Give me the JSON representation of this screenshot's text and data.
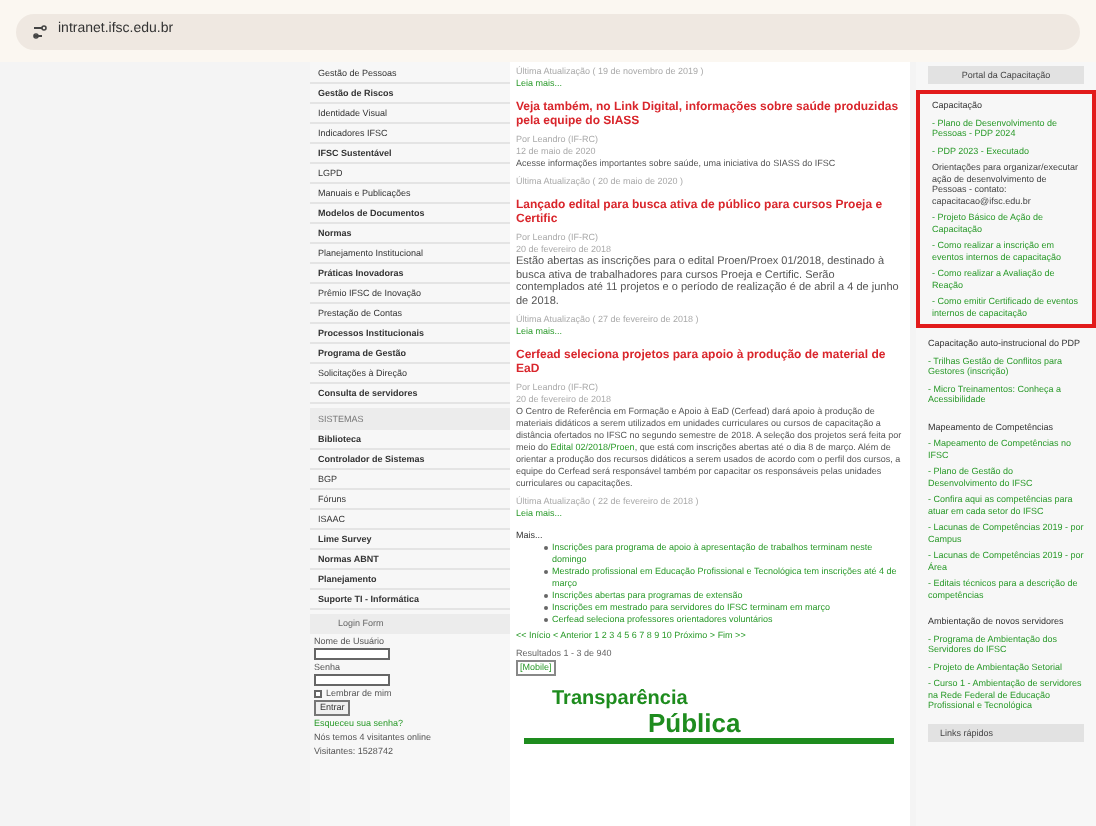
{
  "address_bar": {
    "url": "intranet.ifsc.edu.br"
  },
  "sidebar": {
    "menu": [
      {
        "label": "Gestão de Pessoas",
        "bold": false
      },
      {
        "label": "Gestão de Riscos",
        "bold": true
      },
      {
        "label": "Identidade Visual",
        "bold": false
      },
      {
        "label": "Indicadores IFSC",
        "bold": false
      },
      {
        "label": "IFSC Sustentável",
        "bold": true
      },
      {
        "label": "LGPD",
        "bold": false
      },
      {
        "label": "Manuais e Publicações",
        "bold": false
      },
      {
        "label": "Modelos de Documentos",
        "bold": true
      },
      {
        "label": "Normas",
        "bold": true
      },
      {
        "label": "Planejamento Institucional",
        "bold": false
      },
      {
        "label": "Práticas Inovadoras",
        "bold": true
      },
      {
        "label": "Prêmio IFSC de Inovação",
        "bold": false
      },
      {
        "label": "Prestação de Contas",
        "bold": false
      },
      {
        "label": "Processos Institucionais",
        "bold": true
      },
      {
        "label": "Programa de Gestão",
        "bold": true
      },
      {
        "label": "Solicitações à Direção",
        "bold": false
      },
      {
        "label": "Consulta de servidores",
        "bold": true
      }
    ],
    "systems_heading": "SISTEMAS",
    "systems": [
      {
        "label": "Biblioteca",
        "bold": true
      },
      {
        "label": "Controlador de Sistemas",
        "bold": true
      },
      {
        "label": "BGP",
        "bold": false
      },
      {
        "label": "Fóruns",
        "bold": false
      },
      {
        "label": "ISAAC",
        "bold": false
      },
      {
        "label": "Lime Survey",
        "bold": true
      },
      {
        "label": "Normas ABNT",
        "bold": true
      },
      {
        "label": "Planejamento",
        "bold": true
      },
      {
        "label": "Suporte TI - Informática",
        "bold": true
      }
    ],
    "login": {
      "heading": "Login Form",
      "username_label": "Nome de Usuário",
      "password_label": "Senha",
      "remember_label": "Lembrar de mim",
      "remember_checked": false,
      "submit": "Entrar",
      "forgot": "Esqueceu sua senha?",
      "online": "Nós temos 4 visitantes online",
      "visitors": "Visitantes: 1528742"
    }
  },
  "content": {
    "top_meta": "Última Atualização ( 19 de novembro de 2019 )",
    "top_link": "Leia mais...",
    "articles": [
      {
        "title": "Veja também, no Link Digital, informações sobre saúde produzidas pela equipe do SIASS",
        "author": "Por Leandro (IF-RC)",
        "date": "12 de maio de 2020",
        "body": "Acesse informações importantes sobre saúde, uma iniciativa do SIASS do IFSC",
        "large": false,
        "updated": "Última Atualização ( 20 de maio de 2020 )"
      },
      {
        "title": "Lançado edital para busca ativa de público para cursos Proeja e Certific",
        "author": "Por Leandro (IF-RC)",
        "date": "20 de fevereiro de 2018",
        "body": "Estão abertas as inscrições para o edital Proen/Proex 01/2018, destinado à busca ativa de trabalhadores para cursos Proeja e Certific. Serão contemplados até 11 projetos e o período de realização é de abril a 4 de junho de 2018.",
        "large": true,
        "updated": "Última Atualização ( 27 de fevereiro de 2018 )",
        "more": "Leia mais..."
      },
      {
        "title": "Cerfead seleciona projetos para apoio à produção de material de EaD",
        "author": "Por Leandro (IF-RC)",
        "date": "20 de fevereiro de 2018",
        "body": "O Centro de Referência em Formação e Apoio à EaD (Cerfead) dará apoio à produção de materiais didáticos a serem utilizados em unidades curriculares ou cursos de capacitação a distância ofertados no IFSC no segundo semestre de 2018. A seleção dos projetos será feita por meio do",
        "link": "Edital 02/2018/Proen",
        "body_after": ", que está com inscrições abertas até o dia 8 de março. Além de orientar a produção dos recursos didáticos a serem usados de acordo com o perfil dos cursos, a equipe do Cerfead será responsável também por capacitar os responsáveis pelas unidades curriculares ou capacitações.",
        "large": false,
        "updated": "Última Atualização ( 22 de fevereiro de 2018 )",
        "more": "Leia mais..."
      }
    ],
    "more_heading": "Mais...",
    "more_links": [
      "Inscrições para programa de apoio à apresentação de trabalhos terminam neste domingo",
      "Mestrado profissional em Educação Profissional e Tecnológica tem inscrições até 4 de março",
      "Inscrições abertas para programas de extensão",
      "Inscrições em mestrado para servidores do IFSC terminam em março",
      "Cerfead seleciona professores orientadores voluntários"
    ],
    "pagination": "<< Início < Anterior 1 2 3 4 5 6 7 8 9 10 Próximo > Fim >>",
    "results": "Resultados 1 - 3 de 940",
    "mobile_tag": "[Mobile]",
    "banner": {
      "line1": "Transparência",
      "line2": "Pública"
    }
  },
  "right": {
    "portal_heading": "Portal da Capacitação",
    "sections": [
      {
        "title": "Capacitação",
        "highlighted": true,
        "items": [
          {
            "kind": "link",
            "text": "- Plano de Desenvolvimento de Pessoas - PDP 2024"
          },
          {
            "kind": "link",
            "text": "- PDP 2023 - Executado"
          },
          {
            "kind": "text",
            "text": "Orientações para organizar/executar ação de desenvolvimento de Pessoas - contato: capacitacao@ifsc.edu.br"
          },
          {
            "kind": "link",
            "text": "- Projeto Básico de Ação de Capacitação"
          },
          {
            "kind": "link",
            "text": "- Como realizar a inscrição em eventos internos de capacitação"
          },
          {
            "kind": "link",
            "text": "- Como realizar a Avaliação de Reação"
          },
          {
            "kind": "link",
            "text": "- Como emitir Certificado de eventos internos de capacitação"
          }
        ]
      },
      {
        "title": "Capacitação auto-instrucional do PDP",
        "highlighted": false,
        "items": [
          {
            "kind": "link",
            "text": "- Trilhas Gestão de Conflitos para Gestores (inscrição)"
          },
          {
            "kind": "link",
            "text": "- Micro Treinamentos: Conheça a Acessibilidade"
          }
        ]
      },
      {
        "title": "Mapeamento de Competências",
        "highlighted": false,
        "items": [
          {
            "kind": "link",
            "text": "- Mapeamento de Competências no IFSC"
          },
          {
            "kind": "link",
            "text": "- Plano de Gestão do Desenvolvimento do IFSC"
          },
          {
            "kind": "link",
            "text": "- Confira aqui as competências para atuar em cada setor do IFSC"
          },
          {
            "kind": "link",
            "text": "- Lacunas de Competências 2019 - por Campus"
          },
          {
            "kind": "link",
            "text": "- Lacunas de Competências 2019 - por Área"
          },
          {
            "kind": "link",
            "text": "- Editais técnicos para a descrição de competências"
          }
        ]
      },
      {
        "title": "Ambientação de novos servidores",
        "highlighted": false,
        "items": [
          {
            "kind": "link",
            "text": "- Programa de Ambientação dos Servidores do IFSC"
          },
          {
            "kind": "link",
            "text": "- Projeto de Ambientação Setorial"
          },
          {
            "kind": "link",
            "text": "- Curso 1 - Ambientação de servidores na Rede Federal de Educação Profissional e Tecnológica"
          }
        ]
      }
    ],
    "bottom_heading": "Links rápidos"
  }
}
